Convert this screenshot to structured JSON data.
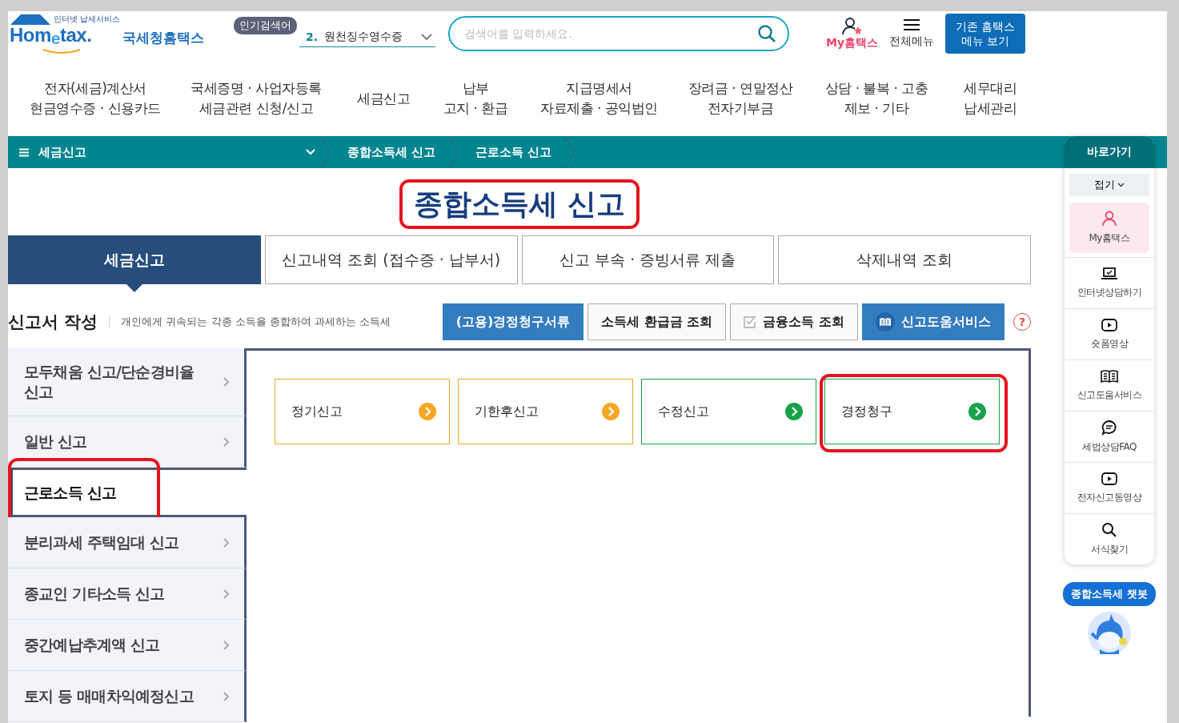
{
  "header": {
    "logo": {
      "tagline": "인터넷 납세서비스",
      "wordmark": "Hom$_{e}$tax.",
      "name": "국세청홈택스"
    },
    "popular": {
      "badge": "인기검색어",
      "rank": "2.",
      "term": "원천징수영수증"
    },
    "search": {
      "placeholder": "검색어를 입력하세요."
    },
    "my_hometax": "My홈택스",
    "all_menu": "전체메뉴",
    "legacy_button": [
      "기존 홈택스",
      "메뉴 보기"
    ]
  },
  "nav": [
    {
      "lines": [
        "전자(세금)계산서",
        "현금영수증 · 신용카드"
      ]
    },
    {
      "lines": [
        "국세증명 · 사업자등록",
        "세금관련 신청/신고"
      ]
    },
    {
      "lines": [
        "세금신고"
      ]
    },
    {
      "lines": [
        "납부",
        "고지 · 환급"
      ]
    },
    {
      "lines": [
        "지급명세서",
        "자료제출 · 공익법인"
      ]
    },
    {
      "lines": [
        "장려금 · 연말정산",
        "전자기부금"
      ]
    },
    {
      "lines": [
        "상담 · 불복 · 고충",
        "제보 · 기타"
      ]
    },
    {
      "lines": [
        "세무대리",
        "납세관리"
      ]
    }
  ],
  "breadcrumb": {
    "menu": "세금신고",
    "items": [
      "종합소득세 신고",
      "근로소득 신고"
    ]
  },
  "title": {
    "text": "종합소득세 신고",
    "circled": true
  },
  "tabs": [
    {
      "label": "세금신고",
      "selected": true
    },
    {
      "label": "신고내역 조회 (접수증 · 납부서)",
      "selected": false
    },
    {
      "label": "신고 부속 · 증빙서류 제출",
      "selected": false
    },
    {
      "label": "삭제내역 조회",
      "selected": false
    }
  ],
  "section": {
    "heading": "신고서 작성",
    "description": "개인에게 귀속되는 각종 소득을 종합하여 과세하는 소득세"
  },
  "actions": [
    {
      "label": "(고용)경정청구서류",
      "kind": "primary"
    },
    {
      "label": "소득세 환급금 조회",
      "kind": "plain"
    },
    {
      "label": "금융소득 조회",
      "kind": "check"
    },
    {
      "label": "신고도움서비스",
      "kind": "book"
    }
  ],
  "help": "?",
  "menu": [
    {
      "label": "모두채움 신고/단순경비율 신고",
      "selected": false,
      "circled": false
    },
    {
      "label": "일반 신고",
      "selected": false,
      "circled": false
    },
    {
      "label": "근로소득 신고",
      "selected": true,
      "circled": true
    },
    {
      "label": "분리과세 주택임대 신고",
      "selected": false,
      "circled": false
    },
    {
      "label": "종교인 기타소득 신고",
      "selected": false,
      "circled": false
    },
    {
      "label": "중간예납추계액 신고",
      "selected": false,
      "circled": false
    },
    {
      "label": "토지 등 매매차익예정신고",
      "selected": false,
      "circled": false
    }
  ],
  "cards": [
    {
      "label": "정기신고",
      "color": "#f5a623",
      "circled": false
    },
    {
      "label": "기한후신고",
      "color": "#f5a623",
      "circled": false
    },
    {
      "label": "수정신고",
      "color": "#17a34a",
      "circled": false
    },
    {
      "label": "경정청구",
      "color": "#17a34a",
      "circled": true
    }
  ],
  "quick": {
    "title": "바로가기",
    "fold": "접기",
    "items": [
      {
        "label": "My홈택스",
        "kind": "personal"
      },
      {
        "label": "인터넷상담하기",
        "kind": "link"
      },
      {
        "label": "숏폼영상",
        "kind": "link"
      },
      {
        "label": "신고도움서비스",
        "kind": "link"
      },
      {
        "label": "세법상담FAQ",
        "kind": "link"
      },
      {
        "label": "전자신고동영상",
        "kind": "link"
      },
      {
        "label": "서식찾기",
        "kind": "link"
      }
    ]
  },
  "chatbot": {
    "label": "종합소득세 챗봇"
  }
}
